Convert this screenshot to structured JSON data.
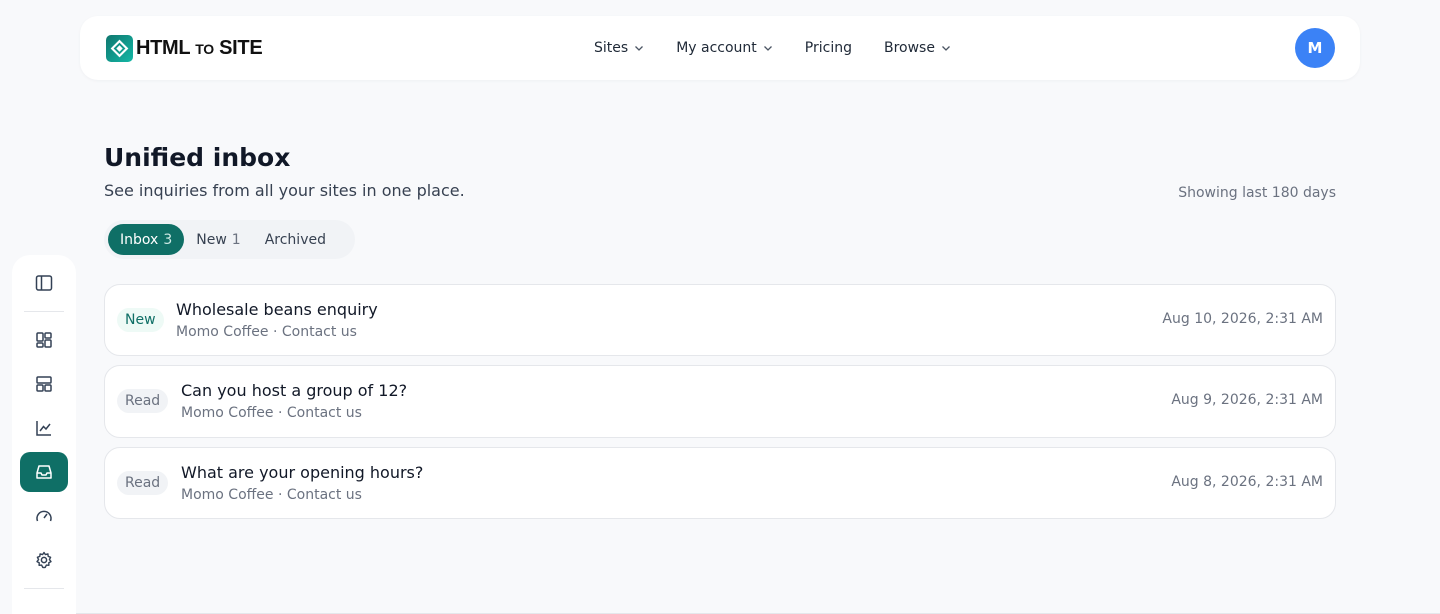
{
  "header": {
    "logo_main": "HTML",
    "logo_small": "TO",
    "logo_end": "SITE",
    "nav": [
      {
        "label": "Sites",
        "has_dropdown": true
      },
      {
        "label": "My account",
        "has_dropdown": true
      },
      {
        "label": "Pricing",
        "has_dropdown": false
      },
      {
        "label": "Browse",
        "has_dropdown": true
      }
    ],
    "avatar_initial": "M"
  },
  "colors": {
    "brand": "#0f6f66",
    "avatar": "#3b82f6",
    "background": "#f8f9fb"
  },
  "sidebar": {
    "items": [
      {
        "icon": "sidebar-toggle-icon",
        "active": false
      },
      {
        "icon": "dashboard-grid-icon",
        "active": false
      },
      {
        "icon": "layout-icon",
        "active": false
      },
      {
        "icon": "analytics-chart-icon",
        "active": false
      },
      {
        "icon": "inbox-icon",
        "active": true
      },
      {
        "icon": "speedometer-icon",
        "active": false
      },
      {
        "icon": "gear-icon",
        "active": false
      }
    ]
  },
  "main": {
    "title": "Unified inbox",
    "subtitle": "See inquiries from all your sites in one place.",
    "range_note": "Showing last 180 days",
    "tabs": [
      {
        "label": "Inbox",
        "count": "3",
        "active": true
      },
      {
        "label": "New",
        "count": "1",
        "active": false
      },
      {
        "label": "Archived",
        "count": "",
        "active": false
      }
    ],
    "messages": [
      {
        "status": "New",
        "subject": "Wholesale beans enquiry",
        "meta": "Momo Coffee · Contact us",
        "date": "Aug 10, 2026, 2:31 AM"
      },
      {
        "status": "Read",
        "subject": "Can you host a group of 12?",
        "meta": "Momo Coffee · Contact us",
        "date": "Aug 9, 2026, 2:31 AM"
      },
      {
        "status": "Read",
        "subject": "What are your opening hours?",
        "meta": "Momo Coffee · Contact us",
        "date": "Aug 8, 2026, 2:31 AM"
      }
    ]
  }
}
